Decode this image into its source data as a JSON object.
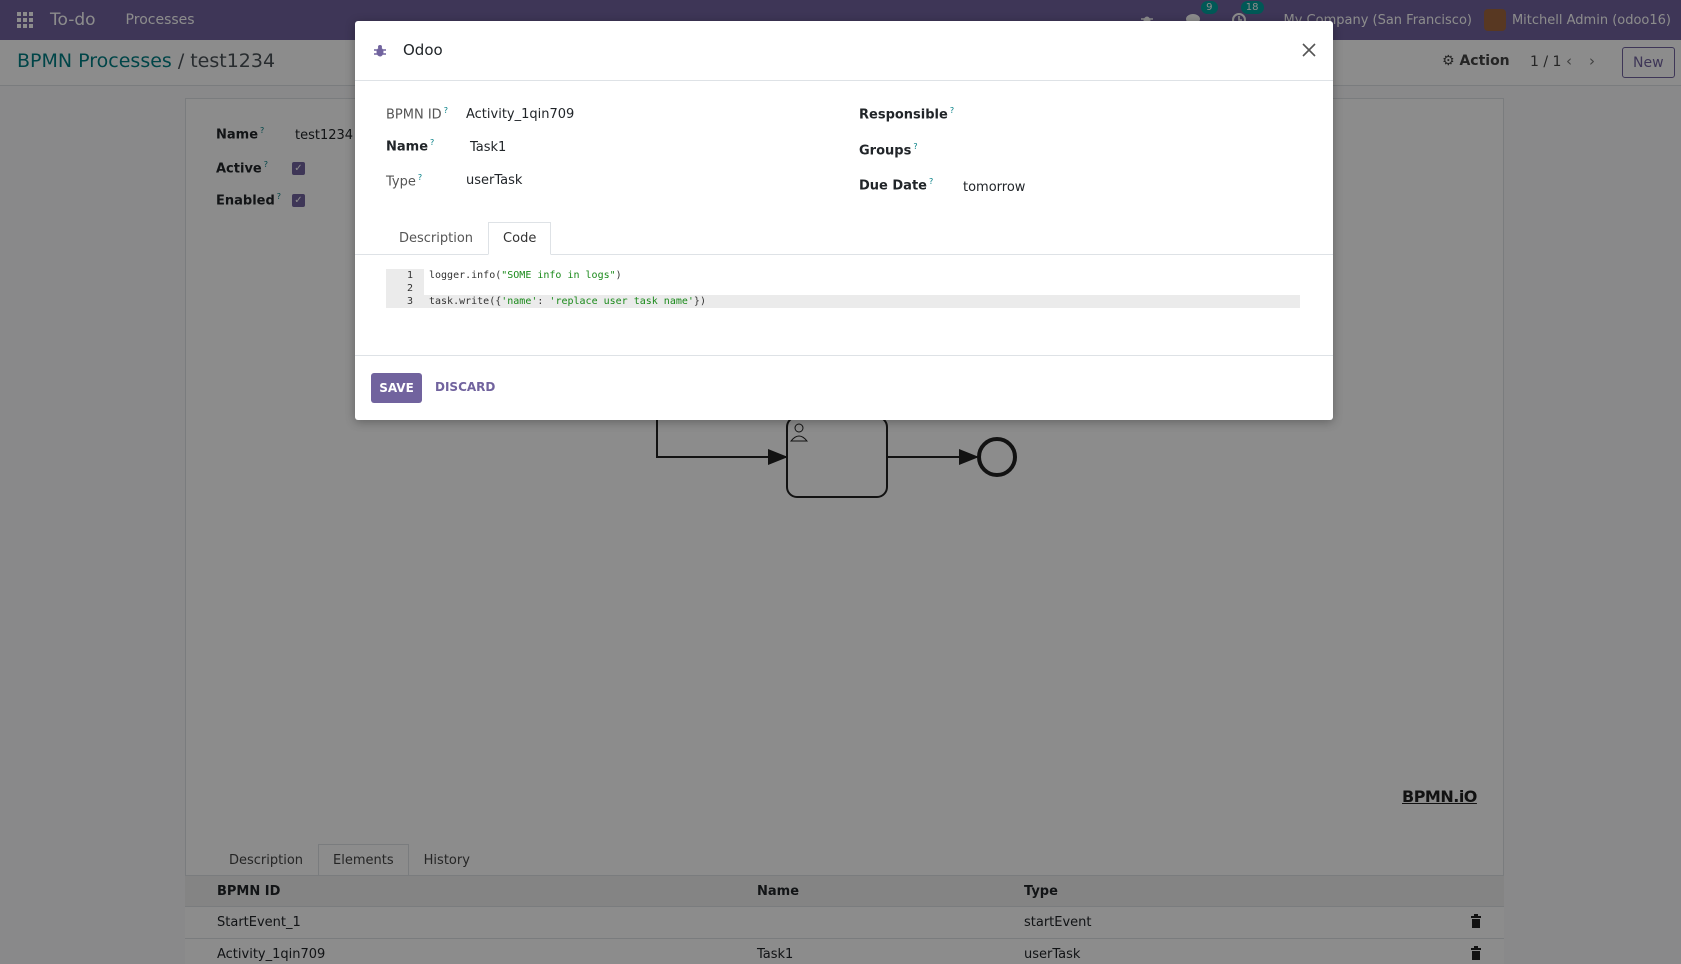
{
  "navbar": {
    "brand": "To-do",
    "menu": "Processes",
    "messages_count": "9",
    "activities_count": "18",
    "company": "My Company (San Francisco)",
    "user": "Mitchell Admin (odoo16)"
  },
  "control": {
    "breadcrumb_parent": "BPMN Processes",
    "breadcrumb_sep": "/",
    "breadcrumb_current": "test1234",
    "action_label": "Action",
    "pager": "1 / 1",
    "new_label": "New"
  },
  "form": {
    "name_label": "Name",
    "name_value": "test1234",
    "active_label": "Active",
    "enabled_label": "Enabled",
    "tooltip_mark": "?",
    "bpmn_logo": "BPMN.iO",
    "tabs": [
      "Description",
      "Elements",
      "History"
    ],
    "table": {
      "headers": [
        "BPMN ID",
        "Name",
        "Type"
      ],
      "rows": [
        {
          "bpmn_id": "StartEvent_1",
          "name": "",
          "type": "startEvent"
        },
        {
          "bpmn_id": "Activity_1qin709",
          "name": "Task1",
          "type": "userTask"
        }
      ]
    }
  },
  "modal": {
    "title": "Odoo",
    "bpmn_id_label": "BPMN ID",
    "bpmn_id_value": "Activity_1qin709",
    "name_label": "Name",
    "name_value": "Task1",
    "type_label": "Type",
    "type_value": "userTask",
    "responsible_label": "Responsible",
    "groups_label": "Groups",
    "due_date_label": "Due Date",
    "due_date_value": "tomorrow",
    "tabs": [
      "Description",
      "Code"
    ],
    "code": {
      "line_numbers": [
        "1",
        "2",
        "3"
      ],
      "line1_a": "logger.info(",
      "line1_str": "\"SOME info in logs\"",
      "line1_b": ")",
      "line3_a": "task.write({",
      "line3_s1": "'name'",
      "line3_colon": ": ",
      "line3_s2": "'replace user task name'",
      "line3_b": "})"
    },
    "save_label": "SAVE",
    "discard_label": "DISCARD"
  },
  "colors": {
    "brand": "#71639e",
    "link": "#017e84",
    "badge": "#00a09d"
  }
}
